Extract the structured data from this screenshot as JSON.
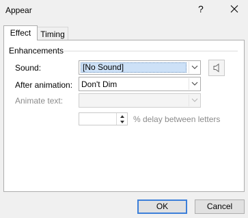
{
  "dialog": {
    "title": "Appear",
    "help": "?",
    "tabs": [
      {
        "label": "Effect",
        "active": true
      },
      {
        "label": "Timing",
        "active": false
      }
    ],
    "enhancements": {
      "group_label": "Enhancements",
      "sound": {
        "label": "Sound:",
        "value": "[No Sound]"
      },
      "after_animation": {
        "label": "After animation:",
        "value": "Don't Dim"
      },
      "animate_text": {
        "label": "Animate text:",
        "value": ""
      },
      "delay": {
        "value": "",
        "label": "% delay between letters"
      }
    },
    "buttons": {
      "ok": "OK",
      "cancel": "Cancel"
    }
  }
}
